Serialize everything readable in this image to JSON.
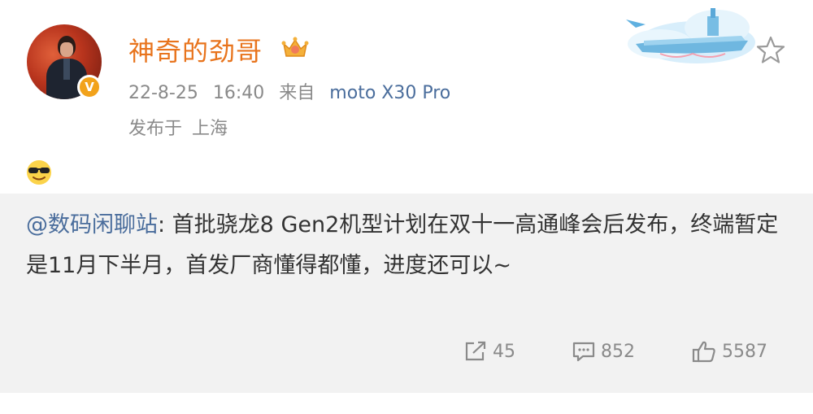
{
  "post": {
    "author": {
      "name": "神奇的劲哥",
      "verified_badge": "V",
      "avatar_icon": "user-avatar",
      "badge_icon": "crown-icon"
    },
    "meta": {
      "date": "22-8-25",
      "time": "16:40",
      "source_prefix": "来自",
      "device": "moto X30 Pro"
    },
    "location": {
      "prefix": "发布于",
      "city": "上海"
    },
    "content_icon": "sunglasses-emoji"
  },
  "repost": {
    "mention": "@数码闲聊站",
    "text": ": 首批骁龙8 Gen2机型计划在双十一高通峰会后发布，终端暂定是11月下半月，首发厂商懂得都懂，进度还可以~"
  },
  "actions": {
    "repost_count": "45",
    "comment_count": "852",
    "like_count": "5587"
  },
  "colors": {
    "username": "#e8741d",
    "link": "#4a6d9c",
    "meta": "#8a8a8a",
    "repost_bg": "#f2f2f2"
  }
}
